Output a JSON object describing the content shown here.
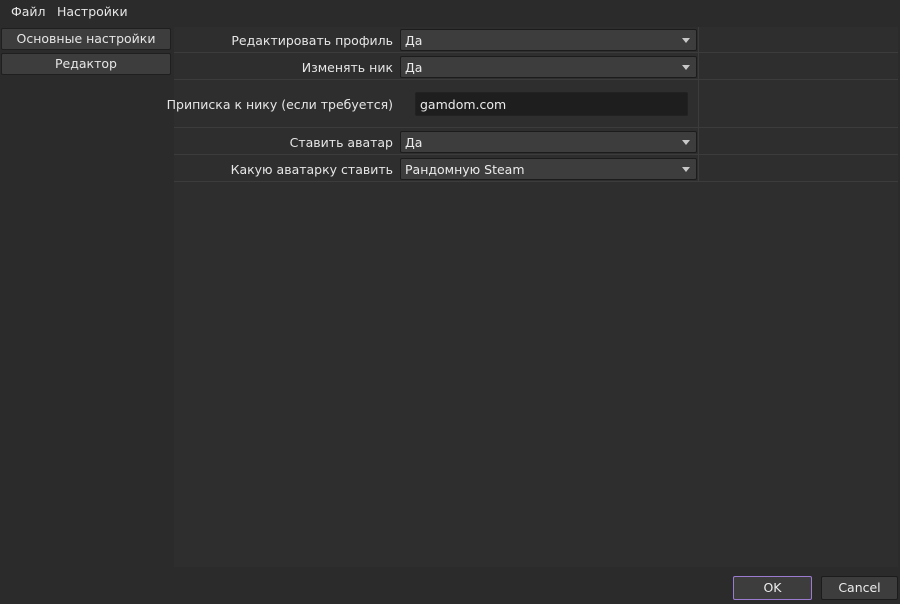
{
  "menu": {
    "file": "Файл",
    "settings": "Настройки"
  },
  "sidebar": {
    "items": [
      {
        "label": "Основные настройки",
        "selected": true
      },
      {
        "label": "Редактор",
        "selected": false
      }
    ]
  },
  "settings": {
    "edit_profile": {
      "label": "Редактировать профиль",
      "value": "Да"
    },
    "change_nick": {
      "label": "Изменять ник",
      "value": "Да"
    },
    "nick_suffix": {
      "label": "Приписка к нику (если требуется)",
      "value": "gamdom.com"
    },
    "set_avatar": {
      "label": "Ставить аватар",
      "value": "Да"
    },
    "avatar_type": {
      "label": "Какую аватарку ставить",
      "value": "Рандомную Steam"
    }
  },
  "footer": {
    "ok_label": "OK",
    "cancel_label": "Cancel"
  },
  "colors": {
    "background": "#2b2b2b",
    "control": "#3d3d3d",
    "input": "#1e1e1e",
    "ok_border": "#9a7bd0"
  }
}
